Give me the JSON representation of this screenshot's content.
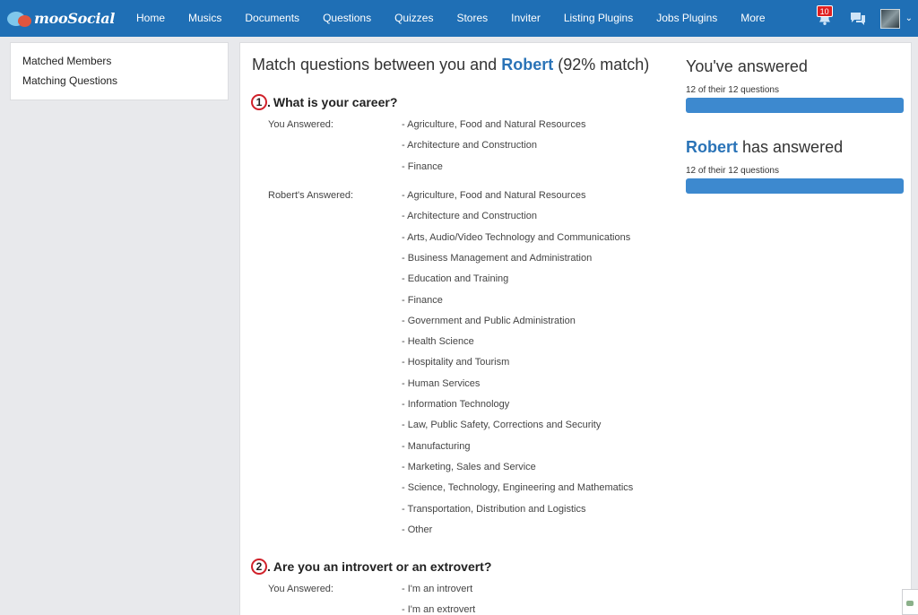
{
  "brand": {
    "name": "mooSocial"
  },
  "nav": {
    "items": [
      "Home",
      "Musics",
      "Documents",
      "Questions",
      "Quizzes",
      "Stores",
      "Inviter",
      "Listing Plugins",
      "Jobs Plugins",
      "More"
    ],
    "notification_count": "10",
    "caret": "⌄"
  },
  "sidebar": {
    "items": [
      "Matched Members",
      "Matching Questions"
    ]
  },
  "header": {
    "prefix": "Match questions between you and",
    "user": "Robert",
    "suffix": "(92% match)"
  },
  "questions": [
    {
      "number": "1",
      "text": "What is your career?",
      "you_label": "You Answered:",
      "you_answers": [
        "Agriculture, Food and Natural Resources",
        "Architecture and Construction",
        "Finance"
      ],
      "their_label": "Robert's Answered:",
      "their_answers": [
        "Agriculture, Food and Natural Resources",
        "Architecture and Construction",
        "Arts, Audio/Video Technology and Communications",
        "Business Management and Administration",
        "Education and Training",
        "Finance",
        "Government and Public Administration",
        "Health Science",
        "Hospitality and Tourism",
        "Human Services",
        "Information Technology",
        "Law, Public Safety, Corrections and Security",
        "Manufacturing",
        "Marketing, Sales and Service",
        "Science, Technology, Engineering and Mathematics",
        "Transportation, Distribution and Logistics",
        "Other"
      ]
    },
    {
      "number": "2",
      "text": "Are you an introvert or an extrovert?",
      "you_label": "You Answered:",
      "you_answers": [
        "I'm an introvert",
        "I'm an extrovert"
      ]
    }
  ],
  "stats": {
    "you_title": "You've answered",
    "you_count": "12 of their 12 questions",
    "you_progress": 1.0,
    "them_name": "Robert",
    "them_title": "has answered",
    "them_count": "12 of their 12 questions",
    "them_progress": 1.0
  },
  "colors": {
    "nav": "#1f6fb5",
    "accent": "#2a73b7",
    "bar": "#3d89cf",
    "marker": "#d0212a"
  }
}
